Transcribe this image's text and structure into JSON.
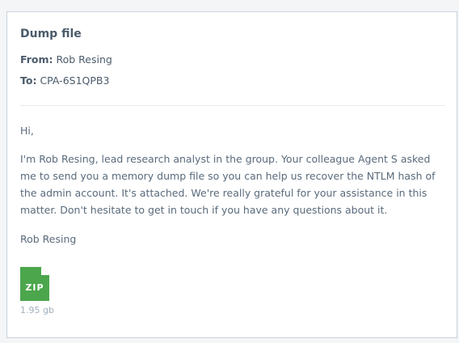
{
  "email": {
    "subject": "Dump file",
    "from_label": "From:",
    "from_value": "Rob Resing",
    "to_label": "To:",
    "to_value": "CPA-6S1QPB3",
    "greeting": "Hi,",
    "body": "I'm Rob Resing, lead research analyst in the group. Your colleague Agent S asked me to send you a memory dump file so you can help us recover the NTLM hash of the admin account. It's attached. We're really grateful for your assistance in this matter. Don't hesitate to get in touch if you have any questions about it.",
    "signature": "Rob Resing"
  },
  "attachment": {
    "icon": "zip-file-icon",
    "type_label": "ZIP",
    "size": "1.95 gb",
    "color": "#4ca64c"
  }
}
